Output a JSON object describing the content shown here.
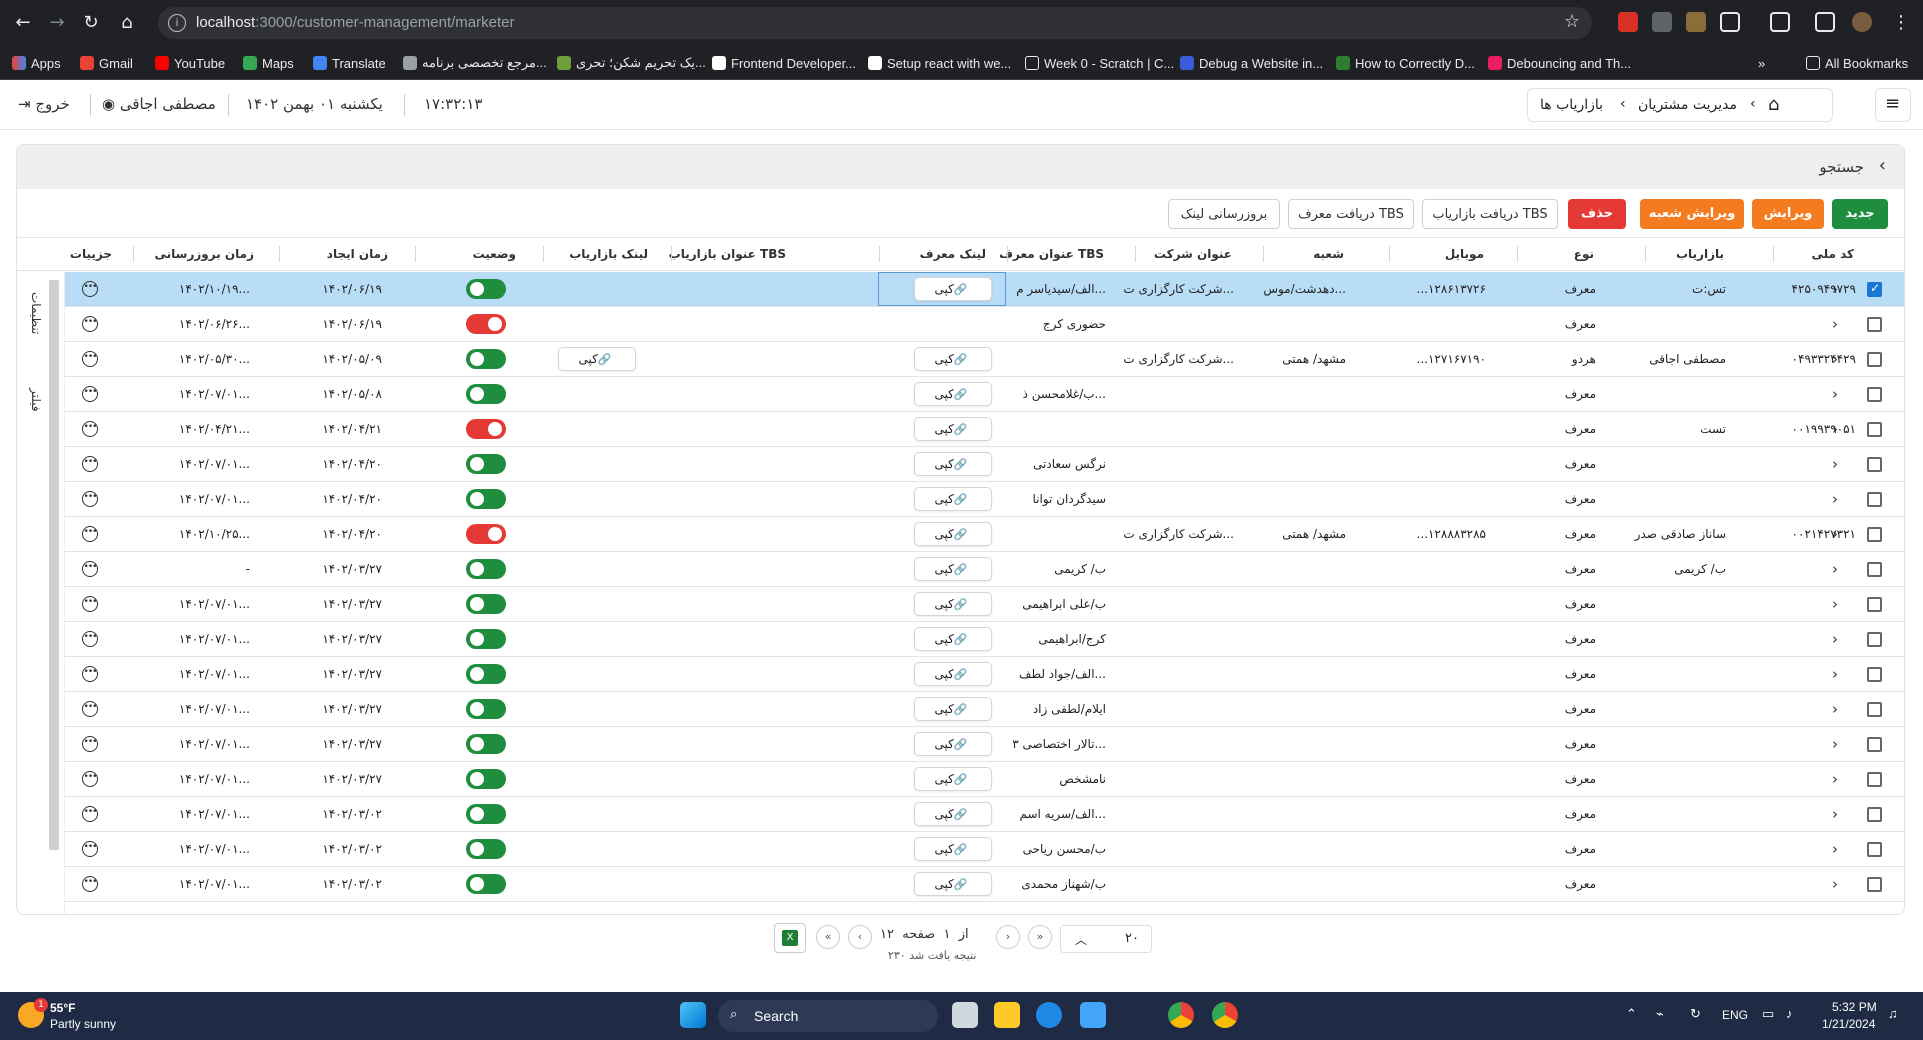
{
  "browser": {
    "url_host": "localhost",
    "url_path": ":3000/customer-management/marketer",
    "bookmarks": [
      "Apps",
      "Gmail",
      "YouTube",
      "Maps",
      "Translate",
      "مرجع تخصصی برنامه...",
      "یک تحریم شکن؛ تحری...",
      "Frontend Developer...",
      "Setup react with we...",
      "Week 0 - Scratch | C...",
      "Debug a Website in...",
      "How to Correctly D...",
      "Debouncing and Th..."
    ],
    "all_bookmarks": "All Bookmarks"
  },
  "header": {
    "logout": "خروج",
    "user": "مصطفی اجاقی",
    "date": "یکشنبه ۰۱ بهمن ۱۴۰۲",
    "time": "۱۷:۳۲:۱۳",
    "breadcrumb": [
      "مدیریت مشتریان",
      "بازاریاب ها"
    ]
  },
  "search": {
    "label": "جستجو"
  },
  "toolbar": {
    "new": "جدید",
    "edit": "ویرایش",
    "edit_branch": "ویرایش شعبه",
    "delete": "حذف",
    "get_tbs_marketer": "دریافت بازاریاب TBS",
    "get_tbs_referrer": "دریافت معرف TBS",
    "update_link": "بروزرسانی لینک"
  },
  "table": {
    "columns": {
      "national_code": "کد ملی",
      "marketer": "بازاریاب",
      "type": "نوع",
      "mobile": "موبایل",
      "branch": "شعبه",
      "company": "عنوان شرکت",
      "tbs_referrer": "عنوان معرف TBS",
      "referrer_link": "لینک معرف",
      "tbs_marketer": "عنوان بازاریاب TBS",
      "marketer_link": "لینک بازاریاب",
      "status": "وضعیت",
      "created": "زمان ایجاد",
      "updated": "زمان بروزرسانی",
      "details": "جزییات"
    },
    "copy_label": "کپی",
    "rows": [
      {
        "code": "۴۲۵۰۹۴۹۷۲۹",
        "marketer": "تس:ت",
        "type": "معرف",
        "mobile": "...۱۲۸۶۱۳۷۲۶",
        "branch": "دهدشت/موس...",
        "company": "شرکت کارگزاری ت...",
        "tbs_ref": "الف/سیدیاسر م...",
        "mlink": "",
        "status": "on",
        "created": "۱۴۰۲/۰۶/۱۹",
        "updated": "۱۴۰۲/۱۰/۱۹...",
        "selected": true
      },
      {
        "code": "",
        "marketer": "",
        "type": "معرف",
        "mobile": "",
        "branch": "",
        "company": "",
        "tbs_ref": "حضوری کرج",
        "mlink": "",
        "status": "off",
        "created": "۱۴۰۲/۰۶/۱۹",
        "updated": "۱۴۰۲/۰۶/۲۶...",
        "selected": false,
        "no_ref_copy": true
      },
      {
        "code": "۰۴۹۳۳۲۴۴۲۹",
        "marketer": "مصطفی اجاقی",
        "type": "هردو",
        "mobile": "...۱۲۷۱۶۷۱۹۰",
        "branch": "مشهد/ همتی",
        "company": "شرکت کارگزاری ت...",
        "tbs_ref": "",
        "mlink": "کپی",
        "status": "on",
        "created": "۱۴۰۲/۰۵/۰۹",
        "updated": "۱۴۰۲/۰۵/۳۰...",
        "selected": false
      },
      {
        "code": "",
        "marketer": "",
        "type": "معرف",
        "mobile": "",
        "branch": "",
        "company": "",
        "tbs_ref": "ب/غلامحسن ذ...",
        "mlink": "",
        "status": "on",
        "created": "۱۴۰۲/۰۵/۰۸",
        "updated": "۱۴۰۲/۰۷/۰۱...",
        "selected": false
      },
      {
        "code": "۰۰۱۹۹۳۹۰۵۱",
        "marketer": "تست",
        "type": "معرف",
        "mobile": "",
        "branch": "",
        "company": "",
        "tbs_ref": "",
        "mlink": "",
        "status": "off",
        "created": "۱۴۰۲/۰۴/۲۱",
        "updated": "۱۴۰۲/۰۴/۲۱...",
        "selected": false
      },
      {
        "code": "",
        "marketer": "",
        "type": "معرف",
        "mobile": "",
        "branch": "",
        "company": "",
        "tbs_ref": "نرگس سعادتی",
        "mlink": "",
        "status": "on",
        "created": "۱۴۰۲/۰۴/۲۰",
        "updated": "۱۴۰۲/۰۷/۰۱...",
        "selected": false
      },
      {
        "code": "",
        "marketer": "",
        "type": "معرف",
        "mobile": "",
        "branch": "",
        "company": "",
        "tbs_ref": "سیدگردان توانا",
        "mlink": "",
        "status": "on",
        "created": "۱۴۰۲/۰۴/۲۰",
        "updated": "۱۴۰۲/۰۷/۰۱...",
        "selected": false
      },
      {
        "code": "۰۰۲۱۴۲۷۳۲۱",
        "marketer": "ساناز صادقی صدر",
        "type": "معرف",
        "mobile": "...۱۲۸۸۸۳۲۸۵",
        "branch": "مشهد/ همتی",
        "company": "شرکت کارگزاری ت...",
        "tbs_ref": "",
        "mlink": "",
        "status": "off",
        "created": "۱۴۰۲/۰۴/۲۰",
        "updated": "۱۴۰۲/۱۰/۲۵...",
        "selected": false
      },
      {
        "code": "",
        "marketer": "ب/ کریمی",
        "type": "معرف",
        "mobile": "",
        "branch": "",
        "company": "",
        "tbs_ref": "ب/ کریمی",
        "mlink": "",
        "status": "on",
        "created": "۱۴۰۲/۰۳/۲۷",
        "updated": "-",
        "selected": false
      },
      {
        "code": "",
        "marketer": "",
        "type": "معرف",
        "mobile": "",
        "branch": "",
        "company": "",
        "tbs_ref": "ب/علی ابراهیمی",
        "mlink": "",
        "status": "on",
        "created": "۱۴۰۲/۰۳/۲۷",
        "updated": "۱۴۰۲/۰۷/۰۱...",
        "selected": false
      },
      {
        "code": "",
        "marketer": "",
        "type": "معرف",
        "mobile": "",
        "branch": "",
        "company": "",
        "tbs_ref": "کرج/ابراهیمی",
        "mlink": "",
        "status": "on",
        "created": "۱۴۰۲/۰۳/۲۷",
        "updated": "۱۴۰۲/۰۷/۰۱...",
        "selected": false
      },
      {
        "code": "",
        "marketer": "",
        "type": "معرف",
        "mobile": "",
        "branch": "",
        "company": "",
        "tbs_ref": "الف/جواد لطف...",
        "mlink": "",
        "status": "on",
        "created": "۱۴۰۲/۰۳/۲۷",
        "updated": "۱۴۰۲/۰۷/۰۱...",
        "selected": false
      },
      {
        "code": "",
        "marketer": "",
        "type": "معرف",
        "mobile": "",
        "branch": "",
        "company": "",
        "tbs_ref": "ایلام/لطفی زاد",
        "mlink": "",
        "status": "on",
        "created": "۱۴۰۲/۰۳/۲۷",
        "updated": "۱۴۰۲/۰۷/۰۱...",
        "selected": false
      },
      {
        "code": "",
        "marketer": "",
        "type": "معرف",
        "mobile": "",
        "branch": "",
        "company": "",
        "tbs_ref": "تالار اختصاصی ۳...",
        "mlink": "",
        "status": "on",
        "created": "۱۴۰۲/۰۳/۲۷",
        "updated": "۱۴۰۲/۰۷/۰۱...",
        "selected": false
      },
      {
        "code": "",
        "marketer": "",
        "type": "معرف",
        "mobile": "",
        "branch": "",
        "company": "",
        "tbs_ref": "نامشخص",
        "mlink": "",
        "status": "on",
        "created": "۱۴۰۲/۰۳/۲۷",
        "updated": "۱۴۰۲/۰۷/۰۱...",
        "selected": false
      },
      {
        "code": "",
        "marketer": "",
        "type": "معرف",
        "mobile": "",
        "branch": "",
        "company": "",
        "tbs_ref": "الف/سریه اسم...",
        "mlink": "",
        "status": "on",
        "created": "۱۴۰۲/۰۳/۰۲",
        "updated": "۱۴۰۲/۰۷/۰۱...",
        "selected": false
      },
      {
        "code": "",
        "marketer": "",
        "type": "معرف",
        "mobile": "",
        "branch": "",
        "company": "",
        "tbs_ref": "ب/محسن ریاحی",
        "mlink": "",
        "status": "on",
        "created": "۱۴۰۲/۰۳/۰۲",
        "updated": "۱۴۰۲/۰۷/۰۱...",
        "selected": false
      },
      {
        "code": "",
        "marketer": "",
        "type": "معرف",
        "mobile": "",
        "branch": "",
        "company": "",
        "tbs_ref": "ب/شهناز محمدی",
        "mlink": "",
        "status": "on",
        "created": "۱۴۰۲/۰۳/۰۲",
        "updated": "۱۴۰۲/۰۷/۰۱...",
        "selected": false
      }
    ]
  },
  "sidebar": {
    "settings": "تنظیمات",
    "filter": "فیلتر"
  },
  "pagination": {
    "page_size": "۲۰",
    "page_label": "صفحه",
    "page_current": "۱",
    "of_label": "از",
    "page_total": "۱۲",
    "results": "۲۳۰ نتیجه یافت شد"
  },
  "taskbar": {
    "weather_temp": "55°F",
    "weather_desc": "Partly sunny",
    "search": "Search",
    "lang": "ENG",
    "time": "5:32 PM",
    "date": "1/21/2024",
    "badge": "1"
  },
  "colors": {
    "green": "#1e8e3e",
    "orange": "#f47b20",
    "red": "#e53935",
    "selected": "#b9dcf7"
  }
}
